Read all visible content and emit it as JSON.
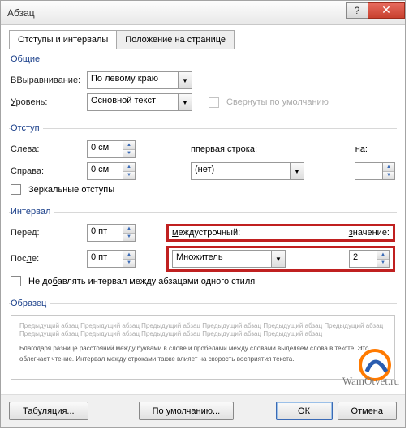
{
  "window": {
    "title": "Абзац",
    "help_icon": "?",
    "close_icon": "✕"
  },
  "tabs": {
    "indents": "Отступы и интервалы",
    "position": "Положение на странице"
  },
  "general": {
    "legend": "Общие",
    "alignment_label": "Выравнивание:",
    "alignment_underline": "В",
    "alignment_value": "По левому краю",
    "level_label": "ровень:",
    "level_underline": "У",
    "level_value": "Основной текст",
    "collapse_label": "Свернуты по умолчанию"
  },
  "indent": {
    "legend": "Отступ",
    "left_label": "ева:",
    "left_underline": "Сл",
    "left_value": "0 см",
    "right_label": "рава:",
    "right_underline": "Сп",
    "right_value": "0 см",
    "firstline_label": "первая строка:",
    "firstline_underline": "п",
    "firstline_value": "(нет)",
    "by_label": "а:",
    "by_underline": "н",
    "by_value": "",
    "mirror_label": "Зеркальные отступы"
  },
  "spacing": {
    "legend": "Интервал",
    "before_label": "Перед:",
    "before_underline": "д",
    "before_value": "0 пт",
    "after_label": "После:",
    "after_underline": "л",
    "after_value": "0 пт",
    "line_label": "еждустрочный:",
    "line_underline": "м",
    "line_value": "Множитель",
    "at_label": "начение:",
    "at_underline": "з",
    "at_value": "2",
    "noadd_label": "Не добавлять интервал между абзацами одного стиля",
    "noadd_underline": "б"
  },
  "preview": {
    "legend": "Образец",
    "gray": "Предыдущий абзац Предыдущий абзац Предыдущий абзац Предыдущий абзац Предыдущий абзац Предыдущий абзац Предыдущий абзац Предыдущий абзац Предыдущий абзац Предыдущий абзац Предыдущий абзац",
    "body": "Благодаря разнице расстояний между буквами в слове и пробелами между словами выделяем слова в тексте. Это облегчает чтение. Интервал между строками также влияет на скорость восприятия текста."
  },
  "buttons": {
    "tabs": "Табуляция...",
    "default": "По умолчанию...",
    "ok": "ОК",
    "cancel": "Отмена"
  },
  "watermark": "WamOtvet.ru"
}
